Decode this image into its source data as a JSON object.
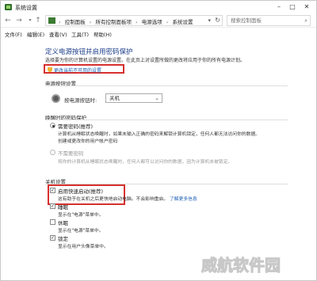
{
  "window": {
    "title": "系统设置",
    "minimize": "–",
    "maximize": "□",
    "close": "✕"
  },
  "address": {
    "back_icon": "arrow-left",
    "forward_icon": "arrow-right",
    "up_icon": "arrow-up",
    "crumbs": [
      "控制面板",
      "所有控制面板项",
      "电源选项",
      "系统设置"
    ],
    "separator": "›",
    "search_placeholder": "搜索控制面板"
  },
  "menu": [
    "文件(F)",
    "编辑(E)",
    "查看(V)",
    "工具(T)",
    "帮助(H)"
  ],
  "page": {
    "title": "定义电源按钮并启用密码保护",
    "description": "选择要为你的计算机设置的电源设置。在此页上对设置所做的更改将应用于你的所有电源计划。",
    "change_link": "更改当前不可用的设置"
  },
  "power_button": {
    "section": "电源按钮设置",
    "label": "按电源按钮时:",
    "value": "关机"
  },
  "wake_password": {
    "section": "唤醒时的密码保护",
    "option1": {
      "label": "需要密码(推荐)",
      "desc1": "计算机从睡眠状态唤醒时，如果未输入正确的密码来解锁计算机锁定，任何人都无法访问你的数据。",
      "link": "创建或更改你的用户帐户密码"
    },
    "option2": {
      "label": "不需要密码",
      "desc1": "将你的计算机从睡眠状态唤醒时，任何人都可以访问你的数据，因为计算机未被锁定。"
    }
  },
  "shutdown": {
    "section": "关机设置",
    "fast_startup": {
      "label": "启用快速启动(推荐)",
      "desc": "这有助于在关机之后更快地启动电脑。不会影响重启。",
      "link": "了解更多信息",
      "checked": true
    },
    "sleep": {
      "label": "睡眠",
      "desc": "显示在\"电源\"菜单中。",
      "checked": true
    },
    "hibernate": {
      "label": "休眠",
      "desc": "显示在\"电源\"菜单中。",
      "checked": false
    },
    "lock": {
      "label": "锁定",
      "desc": "显示在用户头像菜单中。",
      "checked": true
    }
  },
  "watermark": "威航软件园",
  "colors": {
    "title_blue": "#1e3f8a",
    "link_blue": "#1a5fb4",
    "highlight_red": "#d6302e"
  }
}
